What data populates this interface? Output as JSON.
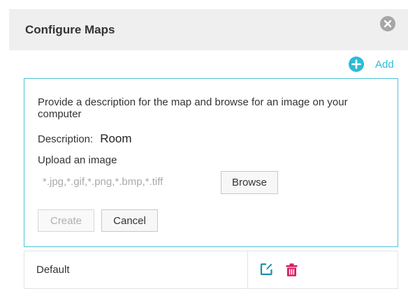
{
  "dialog": {
    "title": "Configure Maps",
    "close_icon": "close-circle-icon"
  },
  "toolbar": {
    "add_label": "Add",
    "add_icon": "plus-circle-icon"
  },
  "form": {
    "instructions": "Provide a description for the map and browse for an image on your computer",
    "description_label": "Description:",
    "description_value": "Room",
    "upload_label": "Upload an image",
    "file_types_hint": "*.jpg,*.gif,*.png,*.bmp,*.tiff",
    "browse_label": "Browse",
    "create_label": "Create",
    "cancel_label": "Cancel",
    "create_disabled": true
  },
  "maps_table": {
    "rows": [
      {
        "name": "Default",
        "actions": [
          "edit-icon",
          "delete-icon"
        ]
      }
    ]
  },
  "colors": {
    "accent": "#2cbbd5",
    "delete": "#d81b60",
    "header_bg": "#efefef",
    "border_accent": "#4fc3d9"
  }
}
